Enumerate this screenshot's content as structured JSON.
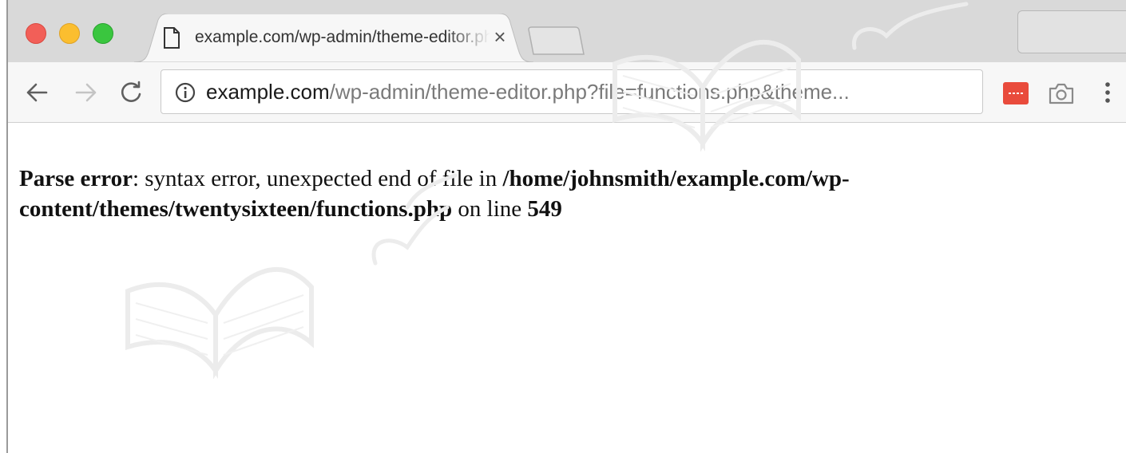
{
  "browser": {
    "tab": {
      "title": "example.com/wp-admin/theme-editor.php",
      "close_glyph": "×"
    },
    "address_bar": {
      "url_host": "example.com",
      "url_path": "/wp-admin/theme-editor.php?file=functions.php&theme..."
    },
    "icons": {
      "back": "back-arrow-icon",
      "forward": "forward-arrow-icon",
      "reload": "reload-icon",
      "info": "info-icon",
      "extension": "extension-icon",
      "camera": "camera-icon",
      "menu": "kebab-menu-icon"
    },
    "colors": {
      "close_dot": "#f25f58",
      "minimize_dot": "#fbbe2f",
      "zoom_dot": "#3ac63f",
      "extension": "#e94b3c"
    }
  },
  "page": {
    "error_label": "Parse error",
    "error_message_1": ": syntax error, unexpected end of file in ",
    "error_path": "/home/johnsmith/example.com/wp-content/themes/twentysixteen/functions.php",
    "error_message_2": " on line ",
    "error_line": "549"
  }
}
